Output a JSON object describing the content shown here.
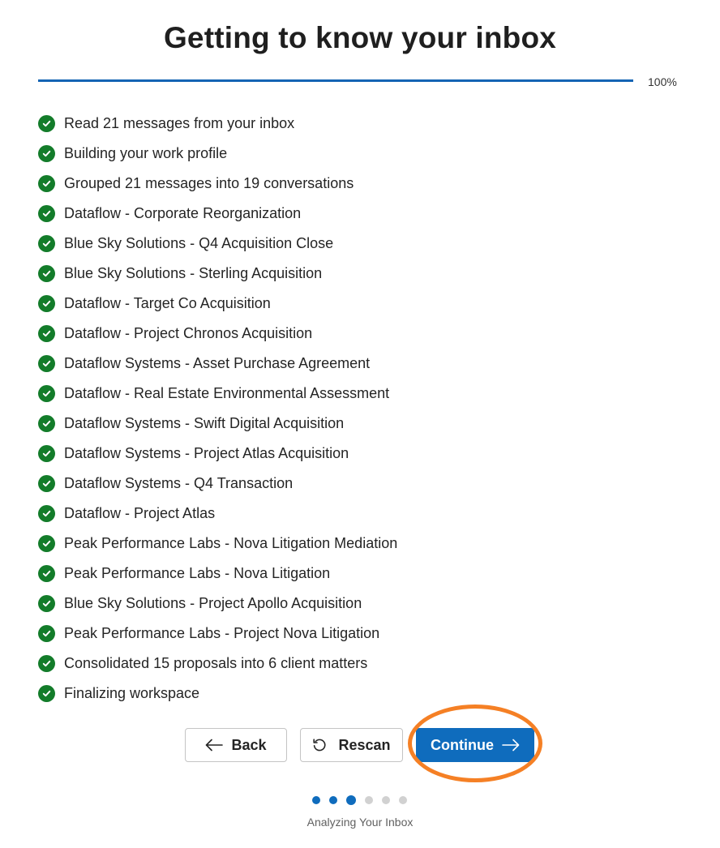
{
  "header": {
    "title": "Getting to know your inbox"
  },
  "progress": {
    "percent_label": "100%",
    "fraction": 1.0
  },
  "steps": [
    {
      "label": "Read 21 messages from your inbox",
      "status": "complete"
    },
    {
      "label": "Building your work profile",
      "status": "complete"
    },
    {
      "label": "Grouped 21 messages into 19 conversations",
      "status": "complete"
    },
    {
      "label": "Dataflow - Corporate Reorganization",
      "status": "complete"
    },
    {
      "label": "Blue Sky Solutions - Q4 Acquisition Close",
      "status": "complete"
    },
    {
      "label": "Blue Sky Solutions - Sterling Acquisition",
      "status": "complete"
    },
    {
      "label": "Dataflow - Target Co Acquisition",
      "status": "complete"
    },
    {
      "label": "Dataflow - Project Chronos Acquisition",
      "status": "complete"
    },
    {
      "label": "Dataflow Systems - Asset Purchase Agreement",
      "status": "complete"
    },
    {
      "label": "Dataflow - Real Estate Environmental Assessment",
      "status": "complete"
    },
    {
      "label": "Dataflow Systems - Swift Digital Acquisition",
      "status": "complete"
    },
    {
      "label": "Dataflow Systems - Project Atlas Acquisition",
      "status": "complete"
    },
    {
      "label": "Dataflow Systems - Q4 Transaction",
      "status": "complete"
    },
    {
      "label": "Dataflow - Project Atlas",
      "status": "complete"
    },
    {
      "label": "Peak Performance Labs - Nova Litigation Mediation",
      "status": "complete"
    },
    {
      "label": "Peak Performance Labs - Nova Litigation",
      "status": "complete"
    },
    {
      "label": "Blue Sky Solutions - Project Apollo Acquisition",
      "status": "complete"
    },
    {
      "label": "Peak Performance Labs - Project Nova Litigation",
      "status": "complete"
    },
    {
      "label": "Consolidated 15 proposals into 6 client matters",
      "status": "complete"
    },
    {
      "label": "Finalizing workspace",
      "status": "complete"
    }
  ],
  "buttons": {
    "back": {
      "label": "Back",
      "icon": "arrow-left-icon"
    },
    "rescan": {
      "label": "Rescan",
      "icon": "rescan-icon"
    },
    "continue": {
      "label": "Continue",
      "icon": "arrow-right-icon"
    }
  },
  "wizard": {
    "total_steps": 6,
    "current_step": 3,
    "step_caption": "Analyzing Your Inbox"
  },
  "colors": {
    "accent": "#0f6cbd",
    "check": "#137c2a",
    "highlight": "#f58025"
  }
}
